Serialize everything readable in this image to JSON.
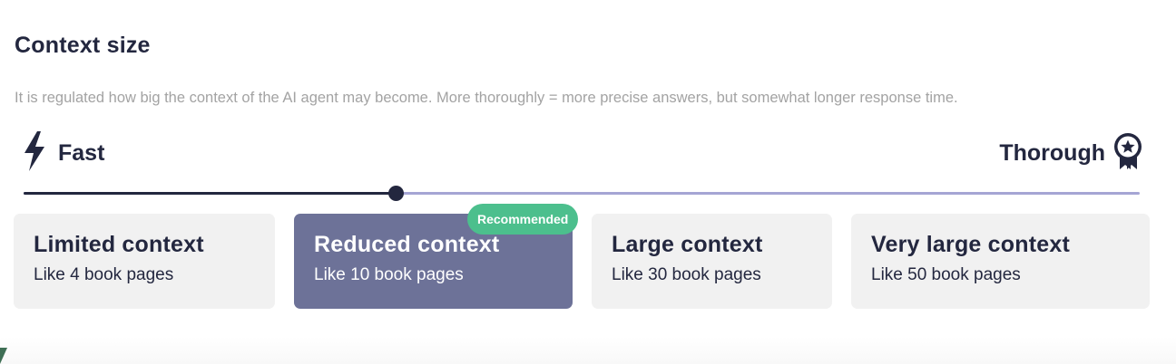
{
  "section": {
    "title": "Context size",
    "description": "It is regulated how big the context of the AI agent may become. More thoroughly = more precise answers, but somewhat longer response time."
  },
  "scale": {
    "left_label": "Fast",
    "left_icon": "lightning-bolt-icon",
    "right_label": "Thorough",
    "right_icon": "award-ribbon-icon",
    "slider_value_fraction": 0.333,
    "colors": {
      "filled": "#23273f",
      "unfilled": "#a5a5d4"
    }
  },
  "options": [
    {
      "title": "Limited context",
      "subtitle": "Like 4 book pages",
      "selected": false
    },
    {
      "title": "Reduced context",
      "subtitle": "Like 10 book pages",
      "selected": true
    },
    {
      "title": "Large context",
      "subtitle": "Like 30 book pages",
      "selected": false
    },
    {
      "title": "Very large context",
      "subtitle": "Like 50 book pages",
      "selected": false
    }
  ],
  "badge": {
    "label": "Recommended",
    "color": "#4cbf8d"
  },
  "colors": {
    "selected_card": "#6d7298",
    "card": "#f1f1f1",
    "text": "#23273f"
  }
}
